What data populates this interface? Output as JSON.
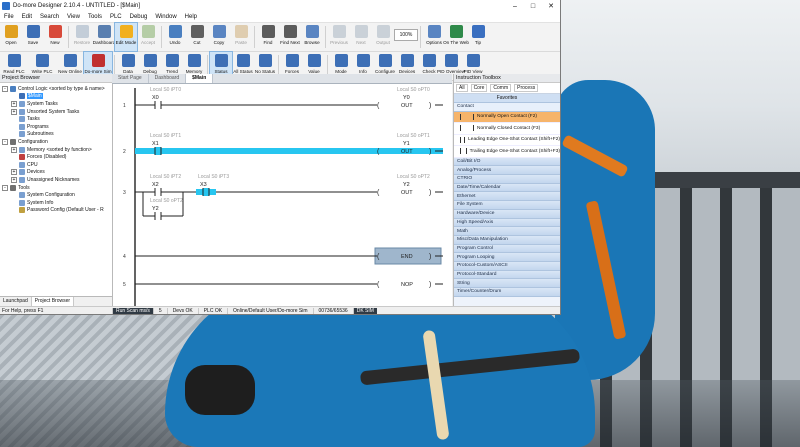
{
  "window": {
    "title": "Do-more Designer 2.10.4 - UNTITLED - [$Main]",
    "minimize": "–",
    "maximize": "□",
    "close": "✕"
  },
  "menu": [
    "File",
    "Edit",
    "Search",
    "View",
    "Tools",
    "PLC",
    "Debug",
    "Window",
    "Help"
  ],
  "toolbar1": [
    {
      "label": "Open",
      "icon": "folder-icon",
      "color": "#e0a020"
    },
    {
      "label": "Save",
      "icon": "save-icon",
      "color": "#3d6fb6"
    },
    {
      "label": "New",
      "icon": "new-icon",
      "color": "#d84a3a"
    },
    {
      "label": "Restore",
      "icon": "restore-icon",
      "color": "#8aa0b8",
      "dim": true
    },
    {
      "label": "Dashboard",
      "icon": "dashboard-icon",
      "color": "#5a7fb0"
    },
    {
      "label": "Edit Mode",
      "icon": "edit-mode-icon",
      "color": "#f1b020",
      "active": true
    },
    {
      "label": "Accept",
      "icon": "accept-icon",
      "color": "#6aa04a",
      "dim": true
    },
    {
      "label": "Undo",
      "icon": "undo-icon",
      "color": "#4a7fc0"
    },
    {
      "label": "Cut",
      "icon": "cut-icon",
      "color": "#606060"
    },
    {
      "label": "Copy",
      "icon": "copy-icon",
      "color": "#5a85c2"
    },
    {
      "label": "Paste",
      "icon": "paste-icon",
      "color": "#c8a060",
      "dim": true
    },
    {
      "label": "Find",
      "icon": "find-icon",
      "color": "#5c5c5c"
    },
    {
      "label": "Find Next",
      "icon": "find-next-icon",
      "color": "#5c5c5c"
    },
    {
      "label": "Browse",
      "icon": "browse-icon",
      "color": "#5a85c2"
    },
    {
      "label": "Previous",
      "icon": "previous-icon",
      "color": "#9aa8b8",
      "dim": true
    },
    {
      "label": "Next",
      "icon": "next-icon",
      "color": "#9aa8b8",
      "dim": true
    },
    {
      "label": "Output",
      "icon": "output-icon",
      "color": "#9aa8b8",
      "dim": true
    }
  ],
  "zoom": "100%",
  "toolbar1_right": [
    {
      "label": "Options",
      "icon": "options-icon",
      "color": "#5a85c2"
    },
    {
      "label": "On The Web",
      "icon": "web-icon",
      "color": "#2f8a4a"
    },
    {
      "label": "Tip",
      "icon": "tip-icon",
      "color": "#3a6fc0"
    }
  ],
  "toolbar2": [
    {
      "label": "Read PLC",
      "icon": "read-plc-icon",
      "color": "#3d6fb6"
    },
    {
      "label": "Write PLC",
      "icon": "write-plc-icon",
      "color": "#3d6fb6"
    },
    {
      "label": "New Online",
      "icon": "new-online-icon",
      "color": "#3d6fb6"
    },
    {
      "label": "Do-more Sim",
      "icon": "sim-icon",
      "color": "#c03030",
      "active": true
    },
    {
      "label": "Data",
      "icon": "data-icon",
      "color": "#3d6fb6"
    },
    {
      "label": "Debug",
      "icon": "debug-icon",
      "color": "#3d6fb6"
    },
    {
      "label": "Trend",
      "icon": "trend-icon",
      "color": "#3d6fb6"
    },
    {
      "label": "Memory",
      "icon": "memory-icon",
      "color": "#3d6fb6"
    },
    {
      "label": "Status",
      "icon": "status-icon",
      "color": "#3d6fb6",
      "active": true
    },
    {
      "label": "All Status",
      "icon": "all-status-icon",
      "color": "#3d6fb6"
    },
    {
      "label": "No Status",
      "icon": "no-status-icon",
      "color": "#3d6fb6"
    },
    {
      "label": "Forces",
      "icon": "forces-icon",
      "color": "#3d6fb6"
    },
    {
      "label": "Value",
      "icon": "value-icon",
      "color": "#3d6fb6"
    },
    {
      "label": "Mode",
      "icon": "mode-icon",
      "color": "#3d6fb6"
    },
    {
      "label": "Info",
      "icon": "info-icon",
      "color": "#3d6fb6"
    },
    {
      "label": "Configure",
      "icon": "configure-icon",
      "color": "#3d6fb6"
    },
    {
      "label": "Devices",
      "icon": "devices-icon",
      "color": "#3d6fb6"
    },
    {
      "label": "Check",
      "icon": "check-icon",
      "color": "#3d6fb6"
    },
    {
      "label": "PID Overview",
      "icon": "pid-overview-icon",
      "color": "#3d6fb6"
    },
    {
      "label": "PID View",
      "icon": "pid-view-icon",
      "color": "#3d6fb6"
    }
  ],
  "project_browser": {
    "title": "Project Browser",
    "tree": [
      {
        "label": "Control Logic <sorted by type & name>",
        "depth": 0,
        "toggle": "-",
        "color": "#4a7fc0"
      },
      {
        "label": "$Main",
        "depth": 1,
        "toggle": "",
        "color": "#3d6fb6",
        "selected": true
      },
      {
        "label": "System Tasks",
        "depth": 1,
        "toggle": "+",
        "color": "#7a9fd0"
      },
      {
        "label": "Unsorted System Tasks",
        "depth": 1,
        "toggle": "+",
        "color": "#7a9fd0"
      },
      {
        "label": "Tasks",
        "depth": 1,
        "toggle": "",
        "color": "#7a9fd0"
      },
      {
        "label": "Programs",
        "depth": 1,
        "toggle": "",
        "color": "#7a9fd0"
      },
      {
        "label": "Subroutines",
        "depth": 1,
        "toggle": "",
        "color": "#7a9fd0"
      },
      {
        "label": "Configuration",
        "depth": 0,
        "toggle": "-",
        "color": "#707070"
      },
      {
        "label": "Memory <sorted by function>",
        "depth": 1,
        "toggle": "+",
        "color": "#7a9fd0"
      },
      {
        "label": "Forces (Disabled)",
        "depth": 1,
        "toggle": "",
        "color": "#c04040"
      },
      {
        "label": "CPU",
        "depth": 1,
        "toggle": "",
        "color": "#7a9fd0"
      },
      {
        "label": "Devices",
        "depth": 1,
        "toggle": "+",
        "color": "#7a9fd0"
      },
      {
        "label": "Unassigned Nicknames",
        "depth": 1,
        "toggle": "+",
        "color": "#7a9fd0"
      },
      {
        "label": "Tools",
        "depth": 0,
        "toggle": "-",
        "color": "#707070"
      },
      {
        "label": "System Configuration",
        "depth": 1,
        "toggle": "",
        "color": "#7a9fd0"
      },
      {
        "label": "System Info",
        "depth": 1,
        "toggle": "",
        "color": "#7a9fd0"
      },
      {
        "label": "Password Config (Default User - R",
        "depth": 1,
        "toggle": "",
        "color": "#c0a040"
      }
    ],
    "tabs": [
      "Launchpad",
      "Project Browser"
    ]
  },
  "doc_tabs": [
    "Start Page",
    "Dashboard",
    "$Main"
  ],
  "ladder": {
    "rungs": [
      {
        "num": "1",
        "contacts": [
          {
            "addr": "X0",
            "comment": "Local S0 iPT0"
          }
        ],
        "coil": {
          "addr": "Y0",
          "comment": "Local S0 oPT0",
          "kind": "OUT"
        }
      },
      {
        "num": "2",
        "contacts": [
          {
            "addr": "X1",
            "comment": "Local S0 iPT1",
            "powered": true
          }
        ],
        "coil": {
          "addr": "Y1",
          "comment": "Local S0 oPT1",
          "kind": "OUT",
          "powered": true
        }
      },
      {
        "num": "3",
        "contacts": [
          {
            "addr": "X2",
            "comment": "Local S0 iPT2"
          },
          {
            "addr": "X3",
            "comment": "Local S0 iPT3",
            "powered": true
          }
        ],
        "branch": {
          "addr": "Y2",
          "comment": "Local S0 oPT2"
        },
        "coil": {
          "addr": "Y2",
          "comment": "Local S0 oPT2",
          "kind": "OUT"
        }
      },
      {
        "num": "4",
        "coil": {
          "kind": "END"
        }
      },
      {
        "num": "5",
        "coil": {
          "kind": "NOP"
        }
      }
    ]
  },
  "toolbox": {
    "title": "Instruction Toolbox",
    "filters": [
      "All",
      "Core",
      "Comm",
      "Process"
    ],
    "favorites": "Favorites",
    "contact_header": "Contact",
    "contact_items": [
      {
        "label": "Normally Open Contact (F2)",
        "hl": true
      },
      {
        "label": "Normally Closed Contact (F3)"
      },
      {
        "label": "Leading Edge One-Shot Contact (Shift+F2)"
      },
      {
        "label": "Trailing Edge One-Shot Contact (Shift+F3)"
      }
    ],
    "categories": [
      "Coil/Bit I/O",
      "Analog/Process",
      "CTRIO",
      "Date/Time/Calendar",
      "Ethernet",
      "File System",
      "Hardware/Device",
      "High Speed/Axis",
      "Math",
      "Misc/Data Manipulation",
      "Program Control",
      "Program Looping",
      "Protocol-Custom/ASCII",
      "Protocol-Standard",
      "String",
      "Timer/Counter/Drum"
    ]
  },
  "status": {
    "help": "For Help, press F1",
    "scan": "Run Scan ms/s",
    "scan_val": "5",
    "cells": [
      "Devs OK",
      "PLC OK",
      "Online/Default User/Do-more Sim",
      "00736/65536",
      "DK SIM"
    ]
  },
  "colors": {
    "powered": "#27c6f0",
    "accent": "#3399ff",
    "highlight": "#f6b46a"
  }
}
